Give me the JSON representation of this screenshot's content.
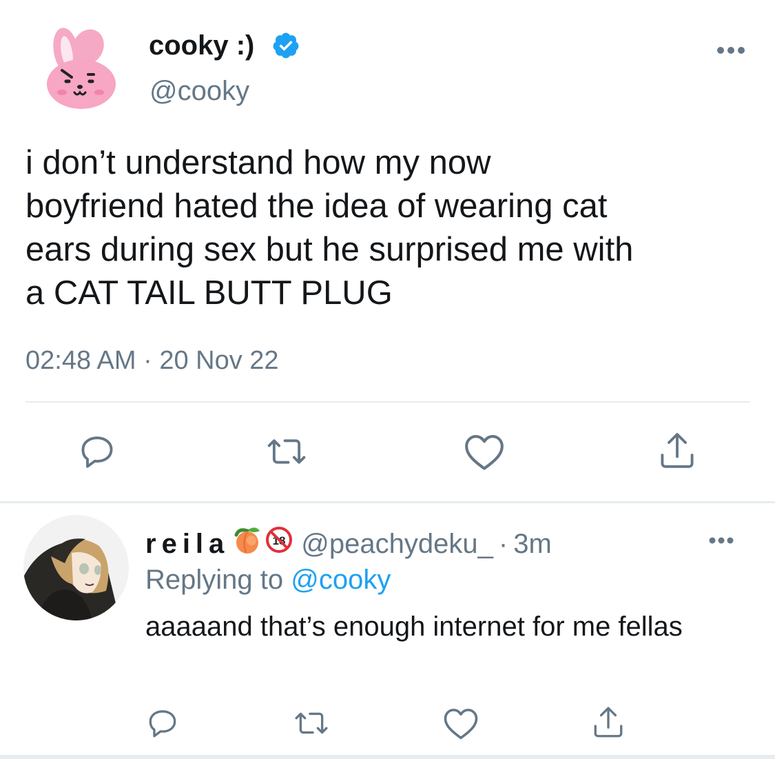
{
  "tweet": {
    "display_name": "cooky :)",
    "handle": "@cooky",
    "text": "i don’t understand how my now\nboyfriend hated the idea of wearing cat\nears during sex but he surprised me with\na CAT TAIL BUTT PLUG",
    "time": "02:48 AM",
    "separator": "·",
    "date": "20 Nov 22",
    "verified": true
  },
  "reply": {
    "display_name": "reila",
    "handle": "@peachydeku_",
    "separator": "·",
    "time_ago": "3m",
    "replying_label": "Replying to",
    "replying_to": "@cooky",
    "text": "aaaaand that’s enough internet for me fellas"
  },
  "icons": {
    "reply": "speech-bubble-icon",
    "retweet": "retweet-icon",
    "like": "heart-icon",
    "share": "share-icon",
    "more": "more-dots-icon",
    "verified": "verified-badge-icon",
    "peach": "peach-emoji-icon",
    "no_under_18": "no-under-18-emoji-icon"
  },
  "colors": {
    "text": "#14171a",
    "secondary": "#657786",
    "accent": "#1da1f2",
    "icon": "#657786",
    "divider": "#e6ecf0"
  }
}
